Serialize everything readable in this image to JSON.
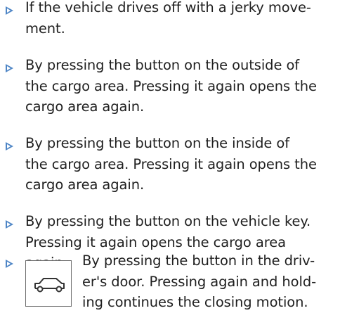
{
  "items": [
    {
      "lines": [
        "If the vehicle drives off with a jerky move-",
        "ment."
      ]
    },
    {
      "lines": [
        "By pressing the button on the outside of",
        "the cargo area. Pressing it again opens the",
        "cargo area again."
      ]
    },
    {
      "lines": [
        "By pressing the button on the inside of",
        "the cargo area. Pressing it again opens the",
        "cargo area again."
      ]
    },
    {
      "lines": [
        "By pressing the button on the vehicle key.",
        "Pressing it again opens the cargo area",
        "again."
      ]
    },
    {
      "icon": "tailgate-car-icon",
      "lines": [
        "By pressing the button in the driv-",
        "er's door. Pressing again and hold-",
        "ing continues the closing motion."
      ]
    }
  ],
  "colors": {
    "bullet": "#4f86c6",
    "text": "#1f1f1f",
    "icon_stroke": "#333333"
  }
}
